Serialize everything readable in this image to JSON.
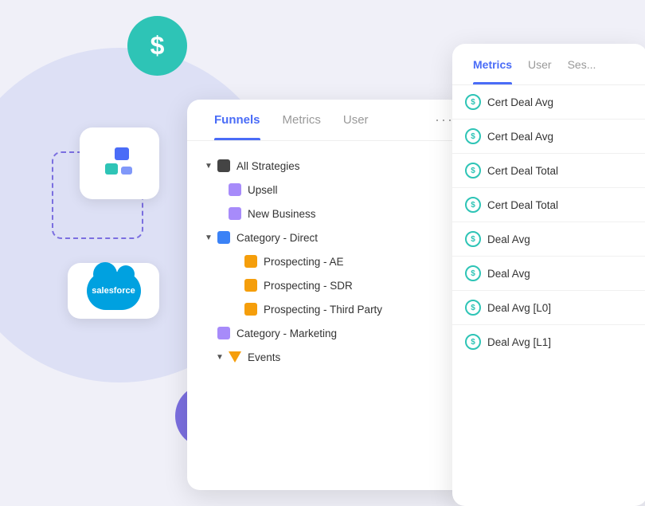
{
  "background": {
    "color": "#f0f0f8"
  },
  "dollar_circle": {
    "symbol": "$"
  },
  "percent_circle": {
    "symbol": "%"
  },
  "main_panel": {
    "tabs": [
      {
        "id": "funnels",
        "label": "Funnels",
        "active": true
      },
      {
        "id": "metrics",
        "label": "Metrics",
        "active": false
      },
      {
        "id": "user",
        "label": "User",
        "active": false
      }
    ],
    "more_label": "···",
    "tree": [
      {
        "id": "all-strategies",
        "label": "All Strategies",
        "indent": 0,
        "arrow": true,
        "color": "#444",
        "type": "square"
      },
      {
        "id": "upsell",
        "label": "Upsell",
        "indent": 1,
        "arrow": false,
        "color": "#a78bfa",
        "type": "square"
      },
      {
        "id": "new-business",
        "label": "New Business",
        "indent": 1,
        "arrow": false,
        "color": "#a78bfa",
        "type": "square"
      },
      {
        "id": "category-direct",
        "label": "Category - Direct",
        "indent": 0,
        "arrow": true,
        "color": "#3b82f6",
        "type": "square"
      },
      {
        "id": "prospecting-ae",
        "label": "Prospecting - AE",
        "indent": 2,
        "arrow": false,
        "color": "#f59e0b",
        "type": "square"
      },
      {
        "id": "prospecting-sdr",
        "label": "Prospecting - SDR",
        "indent": 2,
        "arrow": false,
        "color": "#f59e0b",
        "type": "square"
      },
      {
        "id": "prospecting-third",
        "label": "Prospecting - Third Party",
        "indent": 2,
        "arrow": false,
        "color": "#f59e0b",
        "type": "square"
      },
      {
        "id": "category-marketing",
        "label": "Category - Marketing",
        "indent": 0,
        "arrow": false,
        "color": "#a78bfa",
        "type": "square"
      },
      {
        "id": "events",
        "label": "Events",
        "indent": 1,
        "arrow": true,
        "color": "#f59e0b",
        "type": "triangle"
      }
    ]
  },
  "right_panel": {
    "tabs": [
      {
        "id": "metrics",
        "label": "Metrics",
        "active": true
      },
      {
        "id": "user",
        "label": "User",
        "active": false
      },
      {
        "id": "ses",
        "label": "Ses...",
        "active": false
      }
    ],
    "metrics": [
      {
        "id": "cert-deal-avg-1",
        "label": "Cert Deal Avg"
      },
      {
        "id": "cert-deal-avg-2",
        "label": "Cert Deal Avg"
      },
      {
        "id": "cert-deal-total-1",
        "label": "Cert Deal Total"
      },
      {
        "id": "cert-deal-total-2",
        "label": "Cert Deal Total"
      },
      {
        "id": "deal-avg-1",
        "label": "Deal Avg"
      },
      {
        "id": "deal-avg-2",
        "label": "Deal Avg"
      },
      {
        "id": "deal-avg-l0",
        "label": "Deal Avg [L0]"
      },
      {
        "id": "deal-avg-l1",
        "label": "Deal Avg [L1]"
      }
    ]
  },
  "salesforce": {
    "label": "salesforce"
  }
}
